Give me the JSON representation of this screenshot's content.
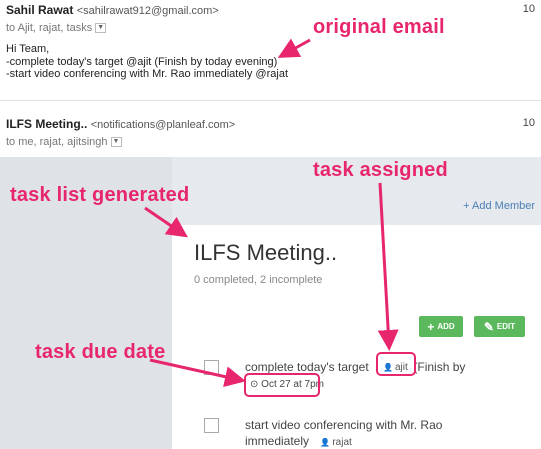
{
  "email1": {
    "sender": "Sahil Rawat",
    "sender_email": "<sahilrawat912@gmail.com>",
    "recipients": "to Ajit, rajat, tasks",
    "time": "10",
    "body": [
      "Hi Team,",
      "-complete today's target @ajit (Finish by today evening)",
      "-start video conferencing with Mr. Rao immediately @rajat"
    ]
  },
  "email2": {
    "sender": "ILFS Meeting..",
    "sender_email": "<notifications@planleaf.com>",
    "recipients": "to me, rajat, ajitsingh",
    "time": "10"
  },
  "tasklist": {
    "add_member": "+ Add Member",
    "title": "ILFS Meeting..",
    "summary": "0 completed,  2 incomplete",
    "add_button": "ADD",
    "edit_button": "EDIT",
    "tasks": [
      {
        "text_before": "complete today's target",
        "assignee": "ajit",
        "text_after": "(Finish by",
        "due": "Oct 27 at 7pm"
      },
      {
        "text_line1": "start video conferencing with Mr. Rao",
        "text_line2": "immediately",
        "assignee": "rajat"
      }
    ]
  },
  "annotations": {
    "original_email": "original email",
    "task_assigned": "task assigned",
    "task_list_generated": "task list generated",
    "task_due_date": "task due date"
  },
  "colors": {
    "annotation": "#e8266e",
    "button_green": "#5cb85c",
    "link_blue": "#4a7fb5"
  }
}
